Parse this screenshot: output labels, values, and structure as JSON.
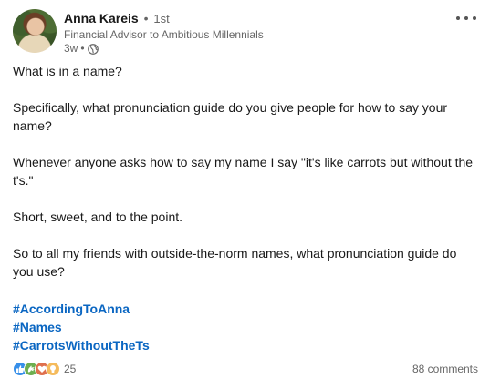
{
  "author": {
    "name": "Anna Kareis",
    "separator": "•",
    "degree": "1st",
    "headline": "Financial Advisor to Ambitious Millennials",
    "time": "3w",
    "meta_separator": "•",
    "visibility_icon": "globe-icon"
  },
  "post": {
    "paragraphs": [
      "What is in a name?",
      "Specifically, what pronunciation guide do you give people for how to say your name?",
      "Whenever anyone asks how to say my name I say \"it's like carrots but without the t's.\"",
      "Short, sweet, and to the point.",
      "So to all my friends with outside-the-norm names, what pronunciation guide do you use?"
    ],
    "hashtags": [
      "#AccordingToAnna",
      "#Names",
      "#CarrotsWithoutTheTs"
    ]
  },
  "social": {
    "reaction_icons": [
      "like-icon",
      "celebrate-icon",
      "love-icon",
      "insightful-icon"
    ],
    "reaction_count": "25",
    "comments": "88 comments"
  },
  "colors": {
    "link": "#0a66c2",
    "muted": "#666666",
    "text": "#191919"
  }
}
